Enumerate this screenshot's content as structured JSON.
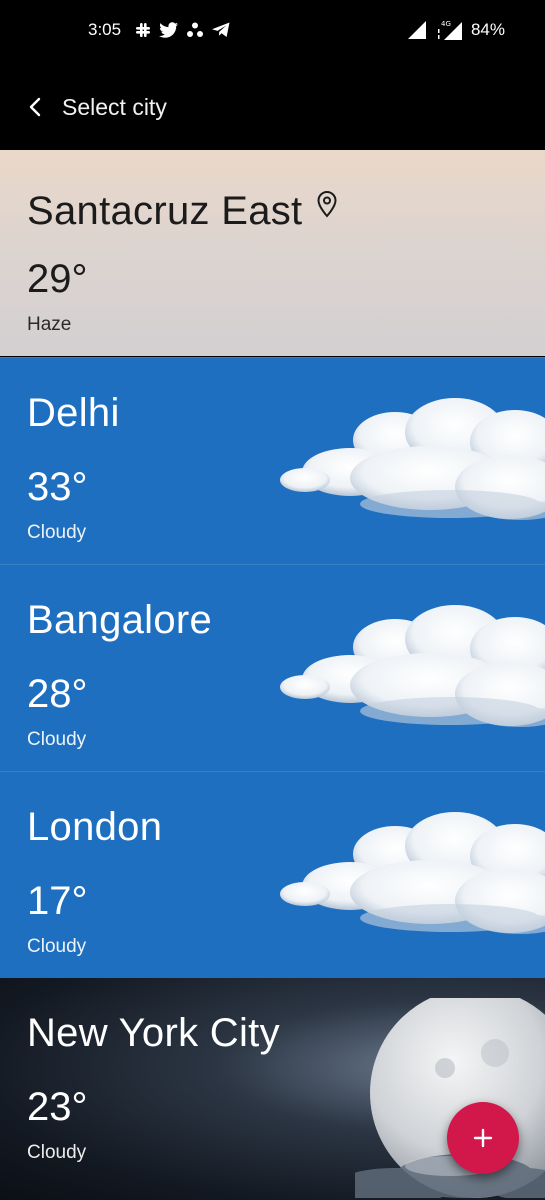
{
  "status_bar": {
    "time": "3:05",
    "network": "4G",
    "battery": "84%",
    "notification_icons": [
      "slack-icon",
      "twitter-icon",
      "app-icon",
      "telegram-icon"
    ]
  },
  "app_bar": {
    "title": "Select city",
    "back_icon": "chevron-left-icon"
  },
  "cities": [
    {
      "name": "Santacruz East",
      "temp": "29°",
      "condition": "Haze",
      "is_current_location": true,
      "theme": "haze"
    },
    {
      "name": "Delhi",
      "temp": "33°",
      "condition": "Cloudy",
      "theme": "cloudy-day"
    },
    {
      "name": "Bangalore",
      "temp": "28°",
      "condition": "Cloudy",
      "theme": "cloudy-day"
    },
    {
      "name": "London",
      "temp": "17°",
      "condition": "Cloudy",
      "theme": "cloudy-day"
    },
    {
      "name": "New York City",
      "temp": "23°",
      "condition": "Cloudy",
      "theme": "cloudy-night"
    }
  ],
  "fab": {
    "icon": "plus-icon",
    "color": "#d2174a"
  },
  "colors": {
    "cloudy_day_bg": "#1e6fbf",
    "app_bar_bg": "#000000"
  }
}
